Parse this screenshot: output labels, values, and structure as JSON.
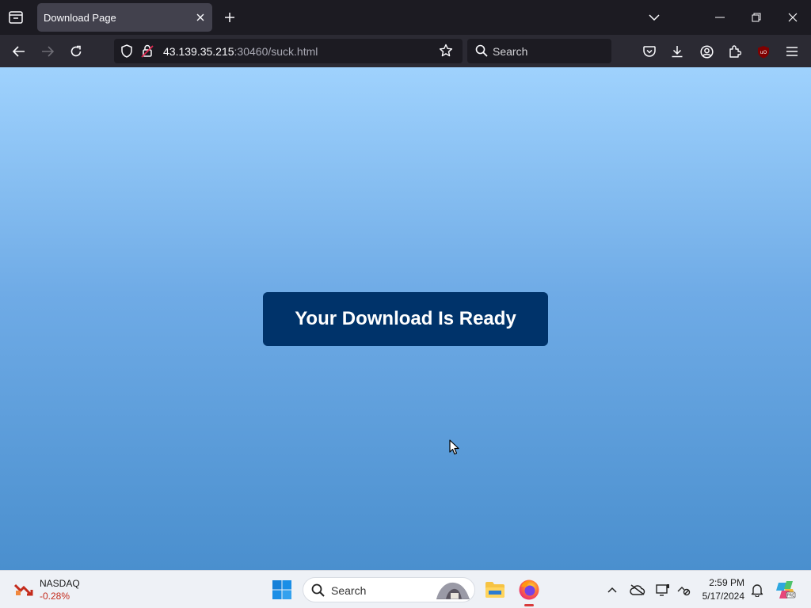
{
  "browser": {
    "tab": {
      "title": "Download Page"
    },
    "url": {
      "host": "43.139.35.215",
      "rest": ":30460/suck.html"
    },
    "search": {
      "placeholder": "Search"
    }
  },
  "page": {
    "download_button": "Your Download Is Ready"
  },
  "taskbar": {
    "stock": {
      "name": "NASDAQ",
      "change": "-0.28%"
    },
    "search": {
      "placeholder": "Search"
    },
    "clock": {
      "time": "2:59 PM",
      "date": "5/17/2024"
    }
  },
  "colors": {
    "accent_button": "#00336a",
    "stock_down": "#c42b1c",
    "browser_dark": "#1c1b22"
  },
  "icons": [
    "tab-list-icon",
    "close-icon",
    "plus-icon",
    "chevron-down-icon",
    "minimize-icon",
    "restore-icon",
    "window-close-icon",
    "back-icon",
    "forward-icon",
    "reload-icon",
    "shield-icon",
    "lock-icon",
    "star-icon",
    "search-icon",
    "pocket-icon",
    "download-icon",
    "account-icon",
    "extensions-icon",
    "ublock-icon",
    "menu-icon",
    "windows-start-icon",
    "file-explorer-icon",
    "firefox-icon",
    "chevron-up-icon",
    "onedrive-icon",
    "display-icon",
    "network-icon",
    "bell-icon",
    "copilot-icon"
  ]
}
